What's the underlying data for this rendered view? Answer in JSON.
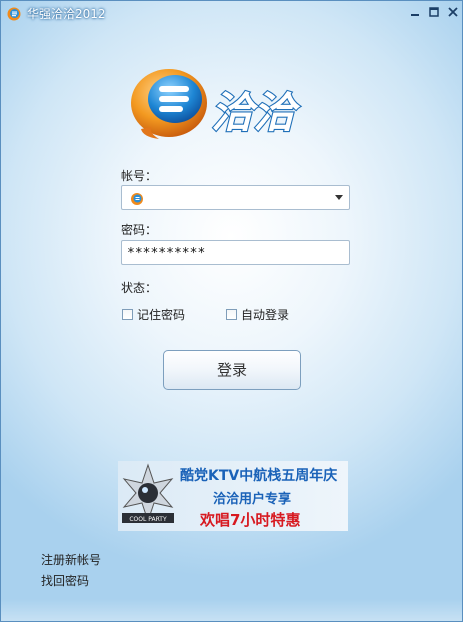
{
  "window": {
    "title": "华强洽洽2012"
  },
  "form": {
    "account_label": "帐号：",
    "password_label": "密码：",
    "password_value": "**********",
    "status_label": "状态：",
    "remember_label": "记住密码",
    "auto_login_label": "自动登录",
    "login_button": "登录"
  },
  "banner": {
    "line1": "酷党KTV中航栈五周年庆",
    "line2": "洽洽用户专享",
    "line3": "欢唱7小时特惠",
    "logo_text": "COOL PARTY"
  },
  "links": {
    "register": "注册新帐号",
    "recover": "找回密码"
  },
  "logo": {
    "text": "洽洽"
  },
  "colors": {
    "accent": "#1f8fd6",
    "orange": "#f08a1c",
    "banner_title": "#1a62b8",
    "banner_red": "#d71920"
  }
}
